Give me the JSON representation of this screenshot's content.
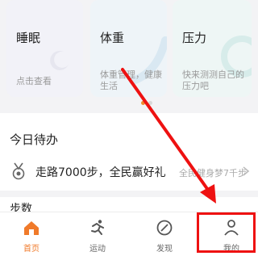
{
  "cards": [
    {
      "title": "睡眠",
      "subtitle": "点击查看"
    },
    {
      "title": "体重",
      "subtitle": "体重管理，健康生活"
    },
    {
      "title": "压力",
      "subtitle": "快来测测自己的压力吧"
    }
  ],
  "todo": {
    "title": "今日待办",
    "item_text": "走路7000步，全民赢好礼",
    "item_right": "全民健身梦7千步"
  },
  "steps": {
    "label": "步数"
  },
  "tabbar": {
    "items": [
      {
        "label": "首页",
        "icon": "home-icon",
        "active": true
      },
      {
        "label": "运动",
        "icon": "running-icon",
        "active": false
      },
      {
        "label": "发现",
        "icon": "discover-icon",
        "active": false
      },
      {
        "label": "我的",
        "icon": "profile-icon",
        "active": false
      }
    ]
  },
  "colors": {
    "accent": "#f07a2a",
    "annotation_red": "#e11111"
  }
}
